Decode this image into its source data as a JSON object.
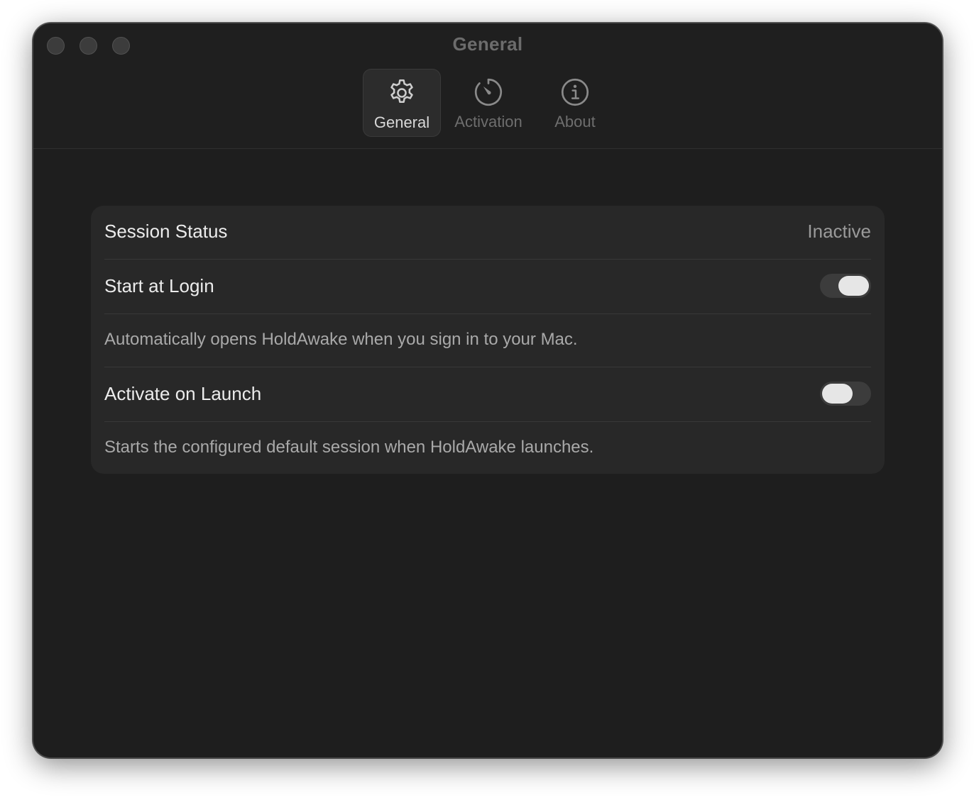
{
  "window": {
    "title": "General"
  },
  "tabs": [
    {
      "label": "General",
      "icon": "gear-icon",
      "active": true
    },
    {
      "label": "Activation",
      "icon": "timer-icon",
      "active": false
    },
    {
      "label": "About",
      "icon": "info-icon",
      "active": false
    }
  ],
  "settings": {
    "session_status_label": "Session Status",
    "session_status_value": "Inactive",
    "start_at_login_label": "Start at Login",
    "start_at_login_enabled": true,
    "start_at_login_desc": "Automatically opens HoldAwake when you sign in to your Mac.",
    "activate_on_launch_label": "Activate on Launch",
    "activate_on_launch_enabled": false,
    "activate_on_launch_desc": "Starts the configured default session when HoldAwake launches."
  },
  "colors": {
    "window_bg": "#1e1e1e",
    "card_bg": "#282828",
    "toggle_track": "#3c3c3c",
    "toggle_knob": "#e6e6e6"
  }
}
